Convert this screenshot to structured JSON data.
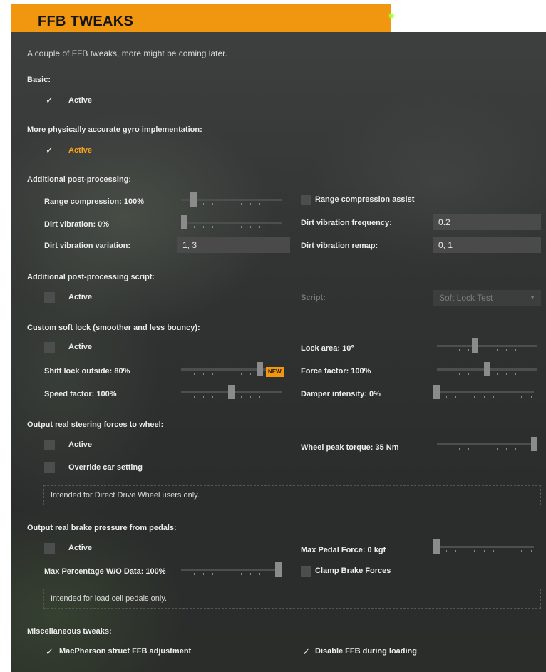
{
  "window": {
    "title": "FFB TWEAKS",
    "status_color": "#a8ff3a",
    "accent": "#f0960f"
  },
  "description": "A couple of FFB tweaks, more might be coming later.",
  "basic": {
    "header": "Basic:",
    "active_label": "Active",
    "active_checked": true
  },
  "gyro": {
    "header": "More physically accurate gyro implementation:",
    "active_label": "Active",
    "active_checked": true
  },
  "postprocessing": {
    "header": "Additional post-processing:",
    "range_compression_label": "Range compression: 100%",
    "range_compression_value": 0.1,
    "range_compression_assist_label": "Range compression assist",
    "range_compression_assist_checked": false,
    "dirt_vibration_label": "Dirt vibration: 0%",
    "dirt_vibration_value": 0.0,
    "dirt_vibration_frequency_label": "Dirt vibration frequency:",
    "dirt_vibration_frequency_value": "0.2",
    "dirt_vibration_variation_label": "Dirt vibration variation:",
    "dirt_vibration_variation_value": "1, 3",
    "dirt_vibration_remap_label": "Dirt vibration remap:",
    "dirt_vibration_remap_value": "0, 1"
  },
  "pp_script": {
    "header": "Additional post-processing script:",
    "active_label": "Active",
    "active_checked": false,
    "script_label": "Script:",
    "script_value": "Soft Lock Test"
  },
  "softlock": {
    "header": "Custom soft lock (smoother and less bouncy):",
    "active_label": "Active",
    "active_checked": false,
    "lock_area_label": "Lock area: 10°",
    "lock_area_value": 0.37,
    "shift_lock_label": "Shift lock outside: 80%",
    "shift_lock_value": 0.8,
    "new_badge": "NEW",
    "force_factor_label": "Force factor: 100%",
    "force_factor_value": 0.5,
    "speed_factor_label": "Speed factor: 100%",
    "speed_factor_value": 0.5,
    "damper_label": "Damper intensity: 0%",
    "damper_value": 0.0
  },
  "steering": {
    "header": "Output real steering forces to wheel:",
    "active_label": "Active",
    "active_checked": false,
    "override_label": "Override car setting",
    "override_checked": false,
    "peak_torque_label": "Wheel peak torque: 35 Nm",
    "peak_torque_value": 1.0,
    "note": "Intended for Direct Drive Wheel users only."
  },
  "brake": {
    "header": "Output real brake pressure from pedals:",
    "active_label": "Active",
    "active_checked": false,
    "max_pedal_label": "Max Pedal Force: 0 kgf",
    "max_pedal_value": 0.0,
    "max_percentage_label": "Max Percentage W/O Data: 100%",
    "max_percentage_value": 1.0,
    "clamp_label": "Clamp Brake Forces",
    "clamp_checked": false,
    "note": "Intended for load cell pedals only."
  },
  "misc": {
    "header": "Miscellaneous tweaks:",
    "macpherson_label": "MacPherson struct FFB adjustment",
    "macpherson_checked": true,
    "disable_loading_label": "Disable FFB during loading",
    "disable_loading_checked": true
  }
}
